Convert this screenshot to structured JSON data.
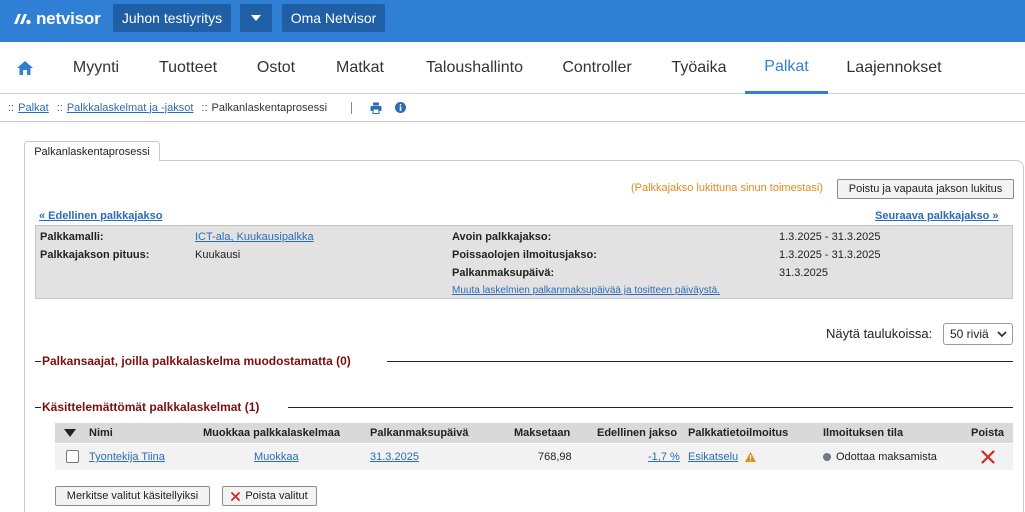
{
  "app": {
    "logo_text": "netvisor",
    "brand_color": "#2f7fd5"
  },
  "topbar": {
    "company_button": "Juhon testiyritys",
    "oma_button": "Oma Netvisor"
  },
  "nav": {
    "items": [
      "Myynti",
      "Tuotteet",
      "Ostot",
      "Matkat",
      "Taloushallinto",
      "Controller",
      "Työaika",
      "Palkat",
      "Laajennokset"
    ],
    "active": "Palkat"
  },
  "breadcrumb": {
    "prefix": "::",
    "items": [
      "Palkat",
      "Palkkalaskelmat ja -jaksot",
      "Palkanlaskentaprosessi"
    ]
  },
  "tab": {
    "label": "Palkanlaskentaprosessi"
  },
  "lock": {
    "note": "(Palkkajakso lukittuna sinun toimestasi)",
    "button": "Poistu ja vapauta jakson lukitus",
    "note_color": "#e08a1e"
  },
  "period_nav": {
    "prev": "« Edellinen palkkajakso",
    "next": "Seuraava palkkajakso »"
  },
  "info": {
    "model_label": "Palkkamalli:",
    "model_value": "ICT-ala, Kuukausipalkka",
    "length_label": "Palkkajakson pituus:",
    "length_value": "Kuukausi",
    "open_label": "Avoin palkkajakso:",
    "open_value": "1.3.2025 - 31.3.2025",
    "absence_label": "Poissaolojen ilmoitusjakso:",
    "absence_value": "1.3.2025 - 31.3.2025",
    "payday_label": "Palkanmaksupäivä:",
    "payday_value": "31.3.2025",
    "change_link": "Muuta laskelmien palkanmaksupäivää ja tositteen päiväystä."
  },
  "per_page": {
    "label": "Näytä taulukoissa:",
    "value": "50 riviä"
  },
  "sections": {
    "no_slip": "Palkansaajat, joilla palkkalaskelma muodostamatta (0)",
    "unprocessed": "Käsittelemättömät palkkalaskelmat (1)"
  },
  "table": {
    "headers": [
      "Nimi",
      "Muokkaa palkkalaskelmaa",
      "Palkanmaksupäivä",
      "Maksetaan",
      "Edellinen jakso",
      "Palkkatietoilmoitus",
      "Ilmoituksen tila",
      "Poista"
    ],
    "rows": [
      {
        "name": "Tyontekija Tiina",
        "edit": "Muokkaa",
        "payday": "31.3.2025",
        "paid": "768,98",
        "previous": "-1,7 %",
        "report": "Esikatselu",
        "status": "Odottaa maksamista"
      }
    ]
  },
  "actions": {
    "mark_processed": "Merkitse valitut käsitellyiksi",
    "delete_selected": "Poista valitut"
  },
  "icons": {
    "logo": "netvisor-logo-icon",
    "home": "home-icon",
    "print": "print-icon",
    "info": "info-icon",
    "warning": "warning-icon",
    "delete": "delete-x-icon",
    "sort": "sort-down-icon"
  }
}
